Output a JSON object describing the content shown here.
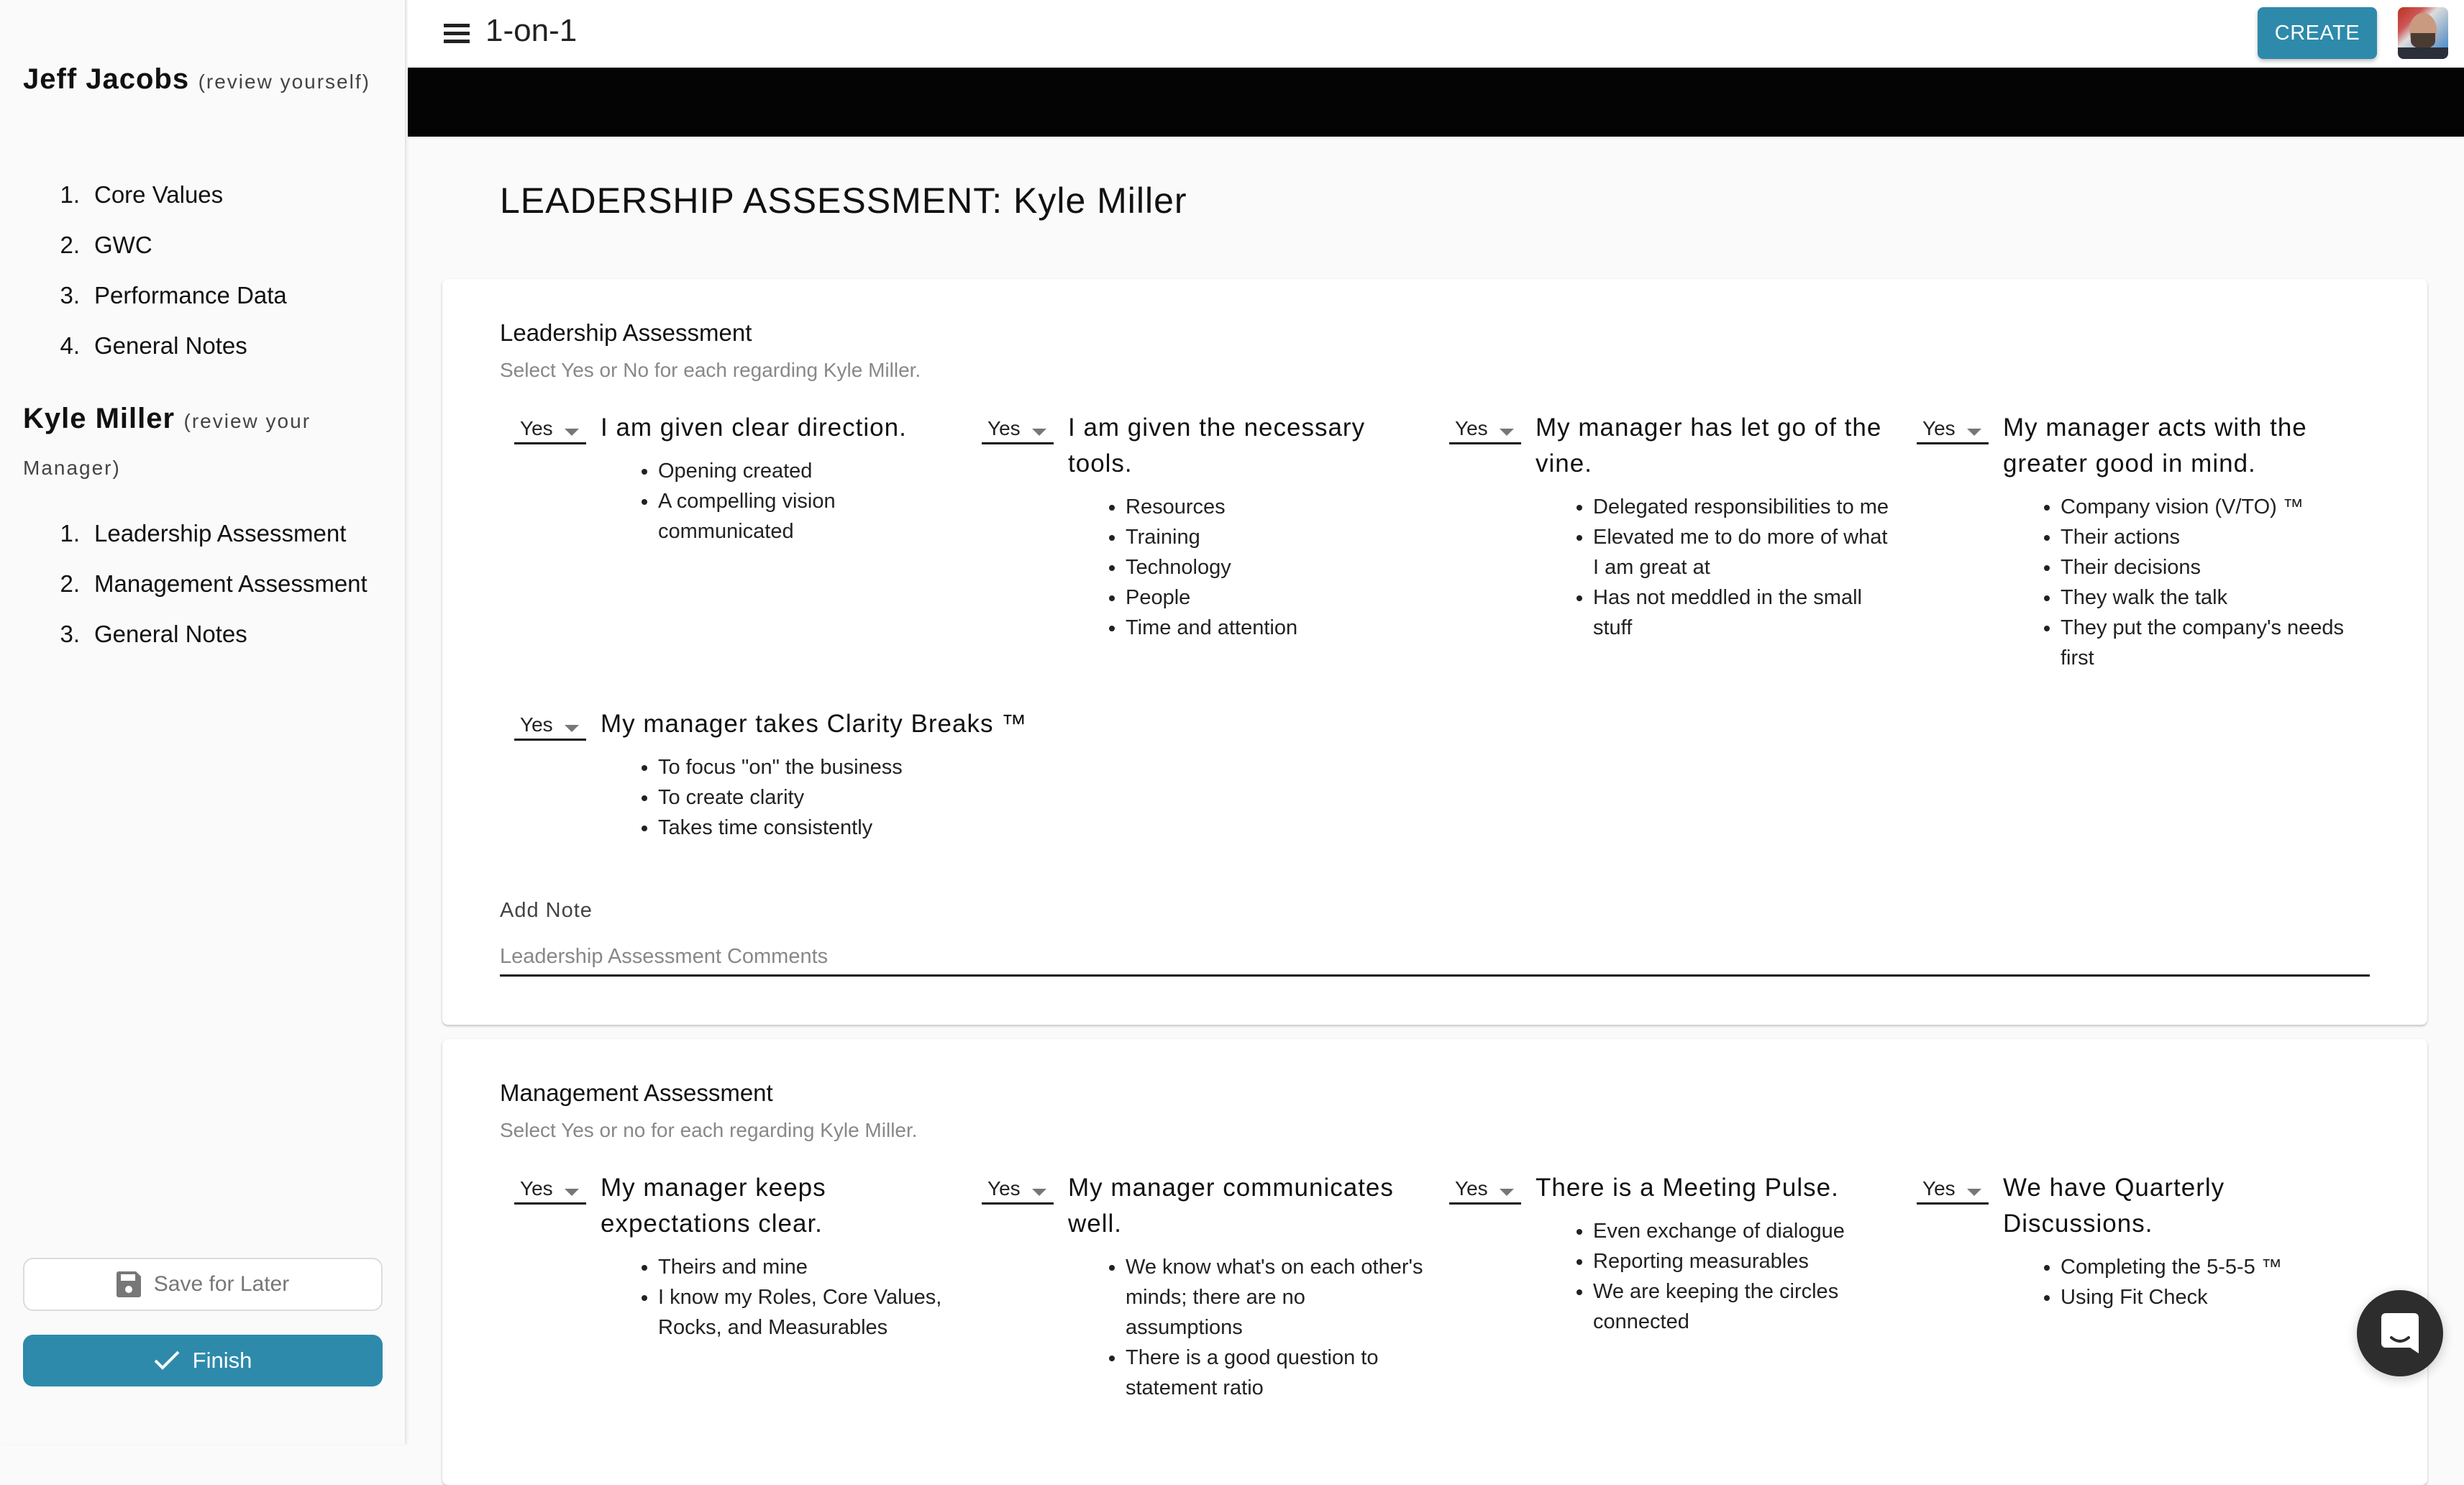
{
  "sidebar": {
    "self": {
      "name": "Jeff Jacobs",
      "sub": "(review yourself)",
      "items": [
        {
          "num": "1.",
          "label": "Core Values"
        },
        {
          "num": "2.",
          "label": "GWC"
        },
        {
          "num": "3.",
          "label": "Performance Data"
        },
        {
          "num": "4.",
          "label": "General Notes"
        }
      ]
    },
    "manager": {
      "name": "Kyle Miller",
      "sub": "(review your Manager)",
      "items": [
        {
          "num": "1.",
          "label": "Leadership Assessment"
        },
        {
          "num": "2.",
          "label": "Management Assessment"
        },
        {
          "num": "3.",
          "label": "General Notes"
        }
      ]
    },
    "save_label": "Save for Later",
    "finish_label": "Finish"
  },
  "topbar": {
    "title": "1-on-1",
    "create_label": "CREATE"
  },
  "page_title": "LEADERSHIP ASSESSMENT: Kyle Miller",
  "leadership": {
    "title": "Leadership Assessment",
    "subtitle": "Select Yes or No for each regarding Kyle Miller.",
    "questions": [
      {
        "answer": "Yes",
        "text": "I am given clear direction.",
        "bullets": [
          "Opening created",
          "A compelling vision communicated"
        ]
      },
      {
        "answer": "Yes",
        "text": "I am given the necessary tools.",
        "bullets": [
          "Resources",
          "Training",
          "Technology",
          "People",
          "Time and attention"
        ]
      },
      {
        "answer": "Yes",
        "text": "My manager has let go of the vine.",
        "bullets": [
          "Delegated responsibilities to me",
          "Elevated me to do more of what I am great at",
          "Has not meddled in the small stuff"
        ]
      },
      {
        "answer": "Yes",
        "text": "My manager acts with the greater good in mind.",
        "bullets": [
          "Company vision (V/TO) ™",
          "Their actions",
          "Their decisions",
          "They walk the talk",
          "They put the company's needs first"
        ]
      },
      {
        "answer": "Yes",
        "text": "My manager takes Clarity Breaks ™",
        "bullets": [
          "To focus \"on\" the business",
          "To create clarity",
          "Takes time consistently"
        ]
      }
    ],
    "note_label": "Add Note",
    "note_placeholder": "Leadership Assessment Comments",
    "note_value": ""
  },
  "management": {
    "title": "Management Assessment",
    "subtitle": "Select Yes or no for each regarding Kyle Miller.",
    "questions": [
      {
        "answer": "Yes",
        "text": "My manager keeps expectations clear.",
        "bullets": [
          "Theirs and mine",
          "I know my Roles, Core Values, Rocks, and Measurables"
        ]
      },
      {
        "answer": "Yes",
        "text": "My manager communicates well.",
        "bullets": [
          "We know what's on each other's minds; there are no assumptions",
          "There is a good question to statement ratio"
        ]
      },
      {
        "answer": "Yes",
        "text": "There is a Meeting Pulse.",
        "bullets": [
          "Even exchange of dialogue",
          "Reporting measurables",
          "We are keeping the circles connected"
        ]
      },
      {
        "answer": "Yes",
        "text": "We have Quarterly Discussions.",
        "bullets": [
          "Completing the 5-5-5 ™",
          "Using Fit Check"
        ]
      }
    ]
  },
  "colors": {
    "accent": "#2e8aab",
    "topband": "#040404",
    "chat": "#2d2d2d"
  }
}
